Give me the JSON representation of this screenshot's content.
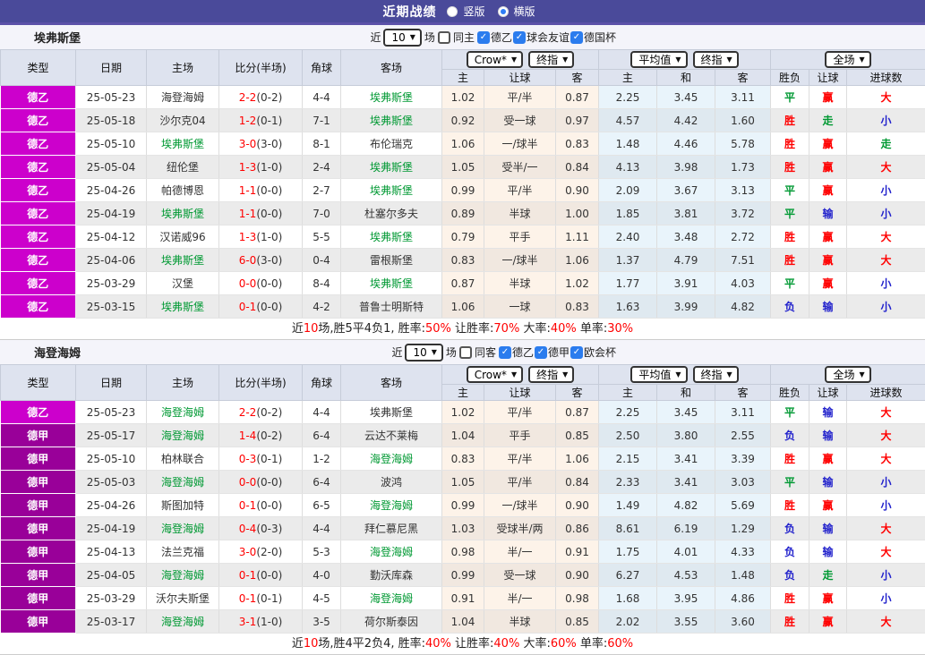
{
  "topbar": {
    "title": "近期战绩",
    "radio_vertical": "竖版",
    "radio_horizontal": "横版",
    "selected": "横版"
  },
  "labels": {
    "near": "近",
    "matches": "场"
  },
  "colors": {
    "topbar": "#4a4a9a",
    "league": {
      "德乙": "#cc00cc",
      "德甲": "#990099"
    },
    "result_win": "#ff0000",
    "result_draw": "#009933",
    "result_lose": "#2222cc",
    "focus_team": "#009933",
    "score": "#ff0000",
    "checkbox": "#2b7cee"
  },
  "table_header": {
    "main": [
      "类型",
      "日期",
      "主场",
      "比分(半场)",
      "角球",
      "客场"
    ],
    "selects": {
      "crow": "Crow*",
      "final1": "终指",
      "avg": "平均值",
      "final2": "终指",
      "full": "全场"
    },
    "sub": [
      "主",
      "让球",
      "客",
      "主",
      "和",
      "客",
      "胜负",
      "让球",
      "进球数"
    ]
  },
  "sections": [
    {
      "title": "埃弗斯堡",
      "near_value": "10",
      "same_label": "同主",
      "same_checked": false,
      "leagues": [
        "德乙",
        "球会友谊",
        "德国杯"
      ],
      "rows": [
        {
          "l": "德乙",
          "d": "25-05-23",
          "h": "海登海姆",
          "hf": false,
          "s": "2-2",
          "sh": "(0-2)",
          "c": "4-4",
          "a": "埃弗斯堡",
          "af": true,
          "o": [
            "1.02",
            "平/半",
            "0.87"
          ],
          "e": [
            "2.25",
            "3.45",
            "3.11"
          ],
          "r": [
            [
              "平",
              "g"
            ],
            [
              "赢",
              "r"
            ],
            [
              "大",
              "r"
            ]
          ]
        },
        {
          "l": "德乙",
          "d": "25-05-18",
          "h": "沙尔克04",
          "hf": false,
          "s": "1-2",
          "sh": "(0-1)",
          "c": "7-1",
          "a": "埃弗斯堡",
          "af": true,
          "o": [
            "0.92",
            "受一球",
            "0.97"
          ],
          "e": [
            "4.57",
            "4.42",
            "1.60"
          ],
          "r": [
            [
              "胜",
              "r"
            ],
            [
              "走",
              "g"
            ],
            [
              "小",
              "b"
            ]
          ]
        },
        {
          "l": "德乙",
          "d": "25-05-10",
          "h": "埃弗斯堡",
          "hf": true,
          "s": "3-0",
          "sh": "(3-0)",
          "c": "8-1",
          "a": "布伦瑞克",
          "af": false,
          "o": [
            "1.06",
            "一/球半",
            "0.83"
          ],
          "e": [
            "1.48",
            "4.46",
            "5.78"
          ],
          "r": [
            [
              "胜",
              "r"
            ],
            [
              "赢",
              "r"
            ],
            [
              "走",
              "g"
            ]
          ]
        },
        {
          "l": "德乙",
          "d": "25-05-04",
          "h": "纽伦堡",
          "hf": false,
          "s": "1-3",
          "sh": "(1-0)",
          "c": "2-4",
          "a": "埃弗斯堡",
          "af": true,
          "o": [
            "1.05",
            "受半/一",
            "0.84"
          ],
          "e": [
            "4.13",
            "3.98",
            "1.73"
          ],
          "r": [
            [
              "胜",
              "r"
            ],
            [
              "赢",
              "r"
            ],
            [
              "大",
              "r"
            ]
          ]
        },
        {
          "l": "德乙",
          "d": "25-04-26",
          "h": "帕德博恩",
          "hf": false,
          "s": "1-1",
          "sh": "(0-0)",
          "c": "2-7",
          "a": "埃弗斯堡",
          "af": true,
          "o": [
            "0.99",
            "平/半",
            "0.90"
          ],
          "e": [
            "2.09",
            "3.67",
            "3.13"
          ],
          "r": [
            [
              "平",
              "g"
            ],
            [
              "赢",
              "r"
            ],
            [
              "小",
              "b"
            ]
          ]
        },
        {
          "l": "德乙",
          "d": "25-04-19",
          "h": "埃弗斯堡",
          "hf": true,
          "s": "1-1",
          "sh": "(0-0)",
          "c": "7-0",
          "a": "杜塞尔多夫",
          "af": false,
          "o": [
            "0.89",
            "半球",
            "1.00"
          ],
          "e": [
            "1.85",
            "3.81",
            "3.72"
          ],
          "r": [
            [
              "平",
              "g"
            ],
            [
              "输",
              "b"
            ],
            [
              "小",
              "b"
            ]
          ]
        },
        {
          "l": "德乙",
          "d": "25-04-12",
          "h": "汉诺威96",
          "hf": false,
          "s": "1-3",
          "sh": "(1-0)",
          "c": "5-5",
          "a": "埃弗斯堡",
          "af": true,
          "o": [
            "0.79",
            "平手",
            "1.11"
          ],
          "e": [
            "2.40",
            "3.48",
            "2.72"
          ],
          "r": [
            [
              "胜",
              "r"
            ],
            [
              "赢",
              "r"
            ],
            [
              "大",
              "r"
            ]
          ]
        },
        {
          "l": "德乙",
          "d": "25-04-06",
          "h": "埃弗斯堡",
          "hf": true,
          "s": "6-0",
          "sh": "(3-0)",
          "c": "0-4",
          "a": "雷根斯堡",
          "af": false,
          "o": [
            "0.83",
            "一/球半",
            "1.06"
          ],
          "e": [
            "1.37",
            "4.79",
            "7.51"
          ],
          "r": [
            [
              "胜",
              "r"
            ],
            [
              "赢",
              "r"
            ],
            [
              "大",
              "r"
            ]
          ]
        },
        {
          "l": "德乙",
          "d": "25-03-29",
          "h": "汉堡",
          "hf": false,
          "s": "0-0",
          "sh": "(0-0)",
          "c": "8-4",
          "a": "埃弗斯堡",
          "af": true,
          "o": [
            "0.87",
            "半球",
            "1.02"
          ],
          "e": [
            "1.77",
            "3.91",
            "4.03"
          ],
          "r": [
            [
              "平",
              "g"
            ],
            [
              "赢",
              "r"
            ],
            [
              "小",
              "b"
            ]
          ]
        },
        {
          "l": "德乙",
          "d": "25-03-15",
          "h": "埃弗斯堡",
          "hf": true,
          "s": "0-1",
          "sh": "(0-0)",
          "c": "4-2",
          "a": "普鲁士明斯特",
          "af": false,
          "o": [
            "1.06",
            "一球",
            "0.83"
          ],
          "e": [
            "1.63",
            "3.99",
            "4.82"
          ],
          "r": [
            [
              "负",
              "b"
            ],
            [
              "输",
              "b"
            ],
            [
              "小",
              "b"
            ]
          ]
        }
      ],
      "summary": {
        "p1": "近",
        "r1": "10",
        "p2": "场,胜5平4负1, 胜率:",
        "r2": "50%",
        "p3": " 让胜率:",
        "r3": "70%",
        "p4": " 大率:",
        "r4": "40%",
        "p5": " 单率:",
        "r5": "30%"
      }
    },
    {
      "title": "海登海姆",
      "near_value": "10",
      "same_label": "同客",
      "same_checked": false,
      "leagues": [
        "德乙",
        "德甲",
        "欧会杯"
      ],
      "rows": [
        {
          "l": "德乙",
          "d": "25-05-23",
          "h": "海登海姆",
          "hf": true,
          "s": "2-2",
          "sh": "(0-2)",
          "c": "4-4",
          "a": "埃弗斯堡",
          "af": false,
          "o": [
            "1.02",
            "平/半",
            "0.87"
          ],
          "e": [
            "2.25",
            "3.45",
            "3.11"
          ],
          "r": [
            [
              "平",
              "g"
            ],
            [
              "输",
              "b"
            ],
            [
              "大",
              "r"
            ]
          ]
        },
        {
          "l": "德甲",
          "d": "25-05-17",
          "h": "海登海姆",
          "hf": true,
          "s": "1-4",
          "sh": "(0-2)",
          "c": "6-4",
          "a": "云达不莱梅",
          "af": false,
          "o": [
            "1.04",
            "平手",
            "0.85"
          ],
          "e": [
            "2.50",
            "3.80",
            "2.55"
          ],
          "r": [
            [
              "负",
              "b"
            ],
            [
              "输",
              "b"
            ],
            [
              "大",
              "r"
            ]
          ]
        },
        {
          "l": "德甲",
          "d": "25-05-10",
          "h": "柏林联合",
          "hf": false,
          "s": "0-3",
          "sh": "(0-1)",
          "c": "1-2",
          "a": "海登海姆",
          "af": true,
          "o": [
            "0.83",
            "平/半",
            "1.06"
          ],
          "e": [
            "2.15",
            "3.41",
            "3.39"
          ],
          "r": [
            [
              "胜",
              "r"
            ],
            [
              "赢",
              "r"
            ],
            [
              "大",
              "r"
            ]
          ]
        },
        {
          "l": "德甲",
          "d": "25-05-03",
          "h": "海登海姆",
          "hf": true,
          "s": "0-0",
          "sh": "(0-0)",
          "c": "6-4",
          "a": "波鸿",
          "af": false,
          "o": [
            "1.05",
            "平/半",
            "0.84"
          ],
          "e": [
            "2.33",
            "3.41",
            "3.03"
          ],
          "r": [
            [
              "平",
              "g"
            ],
            [
              "输",
              "b"
            ],
            [
              "小",
              "b"
            ]
          ]
        },
        {
          "l": "德甲",
          "d": "25-04-26",
          "h": "斯图加特",
          "hf": false,
          "s": "0-1",
          "sh": "(0-0)",
          "c": "6-5",
          "a": "海登海姆",
          "af": true,
          "o": [
            "0.99",
            "一/球半",
            "0.90"
          ],
          "e": [
            "1.49",
            "4.82",
            "5.69"
          ],
          "r": [
            [
              "胜",
              "r"
            ],
            [
              "赢",
              "r"
            ],
            [
              "小",
              "b"
            ]
          ]
        },
        {
          "l": "德甲",
          "d": "25-04-19",
          "h": "海登海姆",
          "hf": true,
          "s": "0-4",
          "sh": "(0-3)",
          "c": "4-4",
          "a": "拜仁慕尼黑",
          "af": false,
          "o": [
            "1.03",
            "受球半/两",
            "0.86"
          ],
          "e": [
            "8.61",
            "6.19",
            "1.29"
          ],
          "r": [
            [
              "负",
              "b"
            ],
            [
              "输",
              "b"
            ],
            [
              "大",
              "r"
            ]
          ]
        },
        {
          "l": "德甲",
          "d": "25-04-13",
          "h": "法兰克福",
          "hf": false,
          "s": "3-0",
          "sh": "(2-0)",
          "c": "5-3",
          "a": "海登海姆",
          "af": true,
          "o": [
            "0.98",
            "半/一",
            "0.91"
          ],
          "e": [
            "1.75",
            "4.01",
            "4.33"
          ],
          "r": [
            [
              "负",
              "b"
            ],
            [
              "输",
              "b"
            ],
            [
              "大",
              "r"
            ]
          ]
        },
        {
          "l": "德甲",
          "d": "25-04-05",
          "h": "海登海姆",
          "hf": true,
          "s": "0-1",
          "sh": "(0-0)",
          "c": "4-0",
          "a": "勤沃库森",
          "af": false,
          "o": [
            "0.99",
            "受一球",
            "0.90"
          ],
          "e": [
            "6.27",
            "4.53",
            "1.48"
          ],
          "r": [
            [
              "负",
              "b"
            ],
            [
              "走",
              "g"
            ],
            [
              "小",
              "b"
            ]
          ]
        },
        {
          "l": "德甲",
          "d": "25-03-29",
          "h": "沃尔夫斯堡",
          "hf": false,
          "s": "0-1",
          "sh": "(0-1)",
          "c": "4-5",
          "a": "海登海姆",
          "af": true,
          "o": [
            "0.91",
            "半/一",
            "0.98"
          ],
          "e": [
            "1.68",
            "3.95",
            "4.86"
          ],
          "r": [
            [
              "胜",
              "r"
            ],
            [
              "赢",
              "r"
            ],
            [
              "小",
              "b"
            ]
          ]
        },
        {
          "l": "德甲",
          "d": "25-03-17",
          "h": "海登海姆",
          "hf": true,
          "s": "3-1",
          "sh": "(1-0)",
          "c": "3-5",
          "a": "荷尔斯泰因",
          "af": false,
          "o": [
            "1.04",
            "半球",
            "0.85"
          ],
          "e": [
            "2.02",
            "3.55",
            "3.60"
          ],
          "r": [
            [
              "胜",
              "r"
            ],
            [
              "赢",
              "r"
            ],
            [
              "大",
              "r"
            ]
          ]
        }
      ],
      "summary": {
        "p1": "近",
        "r1": "10",
        "p2": "场,胜4平2负4, 胜率:",
        "r2": "40%",
        "p3": " 让胜率:",
        "r3": "40%",
        "p4": " 大率:",
        "r4": "60%",
        "p5": " 单率:",
        "r5": "60%"
      }
    }
  ]
}
